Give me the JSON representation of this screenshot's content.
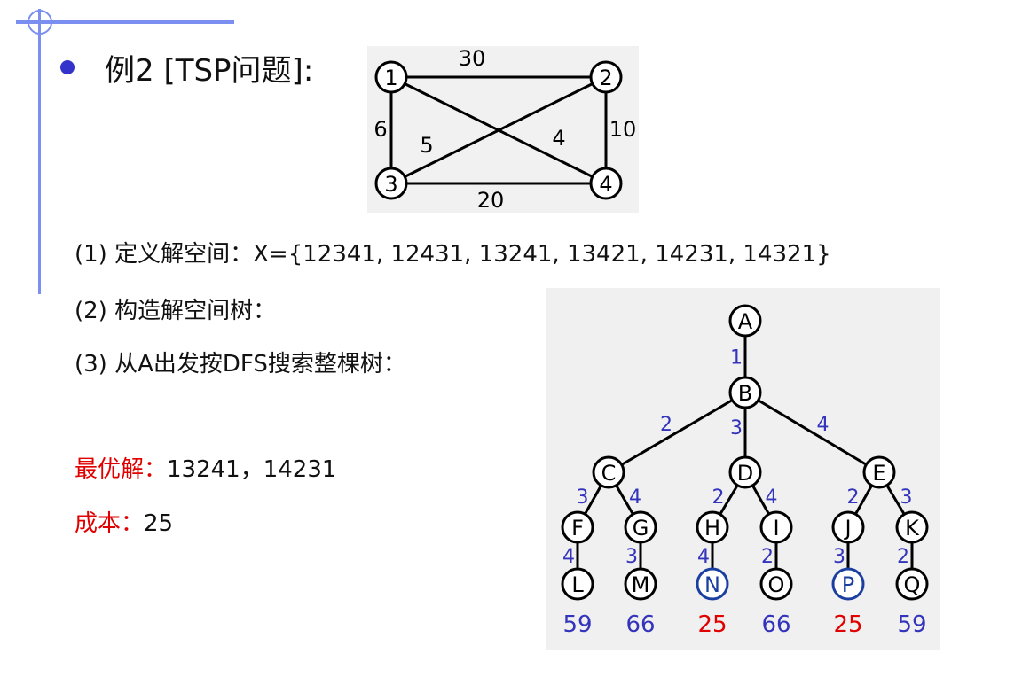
{
  "title": "例2 [TSP问题]:",
  "steps": [
    "(1) 定义解空间：X={12341, 12431, 13241, 13421, 14231, 14321}",
    "(2) 构造解空间树：",
    "(3) 从A出发按DFS搜索整棵树："
  ],
  "optimal": {
    "label": "最优解：",
    "value": "13241，14231"
  },
  "cost": {
    "label": "成本：",
    "value": "25"
  },
  "graph": {
    "nodes": [
      "1",
      "2",
      "3",
      "4"
    ],
    "edges": [
      {
        "from": "1",
        "to": "2",
        "weight": "30"
      },
      {
        "from": "1",
        "to": "3",
        "weight": "6"
      },
      {
        "from": "1",
        "to": "4",
        "weight": "4"
      },
      {
        "from": "2",
        "to": "3",
        "weight": "5"
      },
      {
        "from": "2",
        "to": "4",
        "weight": "10"
      },
      {
        "from": "3",
        "to": "4",
        "weight": "20"
      }
    ]
  },
  "tree": {
    "nodes": [
      "A",
      "B",
      "C",
      "D",
      "E",
      "F",
      "G",
      "H",
      "I",
      "J",
      "K",
      "L",
      "M",
      "N",
      "O",
      "P",
      "Q"
    ],
    "edges": [
      {
        "from": "A",
        "to": "B",
        "label": "1"
      },
      {
        "from": "B",
        "to": "C",
        "label": "2"
      },
      {
        "from": "B",
        "to": "D",
        "label": "3"
      },
      {
        "from": "B",
        "to": "E",
        "label": "4"
      },
      {
        "from": "C",
        "to": "F",
        "label": "3"
      },
      {
        "from": "C",
        "to": "G",
        "label": "4"
      },
      {
        "from": "D",
        "to": "H",
        "label": "2"
      },
      {
        "from": "D",
        "to": "I",
        "label": "4"
      },
      {
        "from": "E",
        "to": "J",
        "label": "2"
      },
      {
        "from": "E",
        "to": "K",
        "label": "3"
      },
      {
        "from": "F",
        "to": "L",
        "label": "4"
      },
      {
        "from": "G",
        "to": "M",
        "label": "3"
      },
      {
        "from": "H",
        "to": "N",
        "label": "4"
      },
      {
        "from": "I",
        "to": "O",
        "label": "2"
      },
      {
        "from": "J",
        "to": "P",
        "label": "3"
      },
      {
        "from": "K",
        "to": "Q",
        "label": "2"
      }
    ],
    "highlighted": [
      "N",
      "P"
    ],
    "leaf_costs": [
      {
        "leaf": "L",
        "cost": "59",
        "optimal": false
      },
      {
        "leaf": "M",
        "cost": "66",
        "optimal": false
      },
      {
        "leaf": "N",
        "cost": "25",
        "optimal": true
      },
      {
        "leaf": "O",
        "cost": "66",
        "optimal": false
      },
      {
        "leaf": "P",
        "cost": "25",
        "optimal": true
      },
      {
        "leaf": "Q",
        "cost": "59",
        "optimal": false
      }
    ]
  },
  "colors": {
    "accent": "#7b8ff0",
    "bullet": "#3333cc",
    "label": "#3333bb",
    "optimal": "#e00000",
    "highlight": "#1a3fa0"
  }
}
